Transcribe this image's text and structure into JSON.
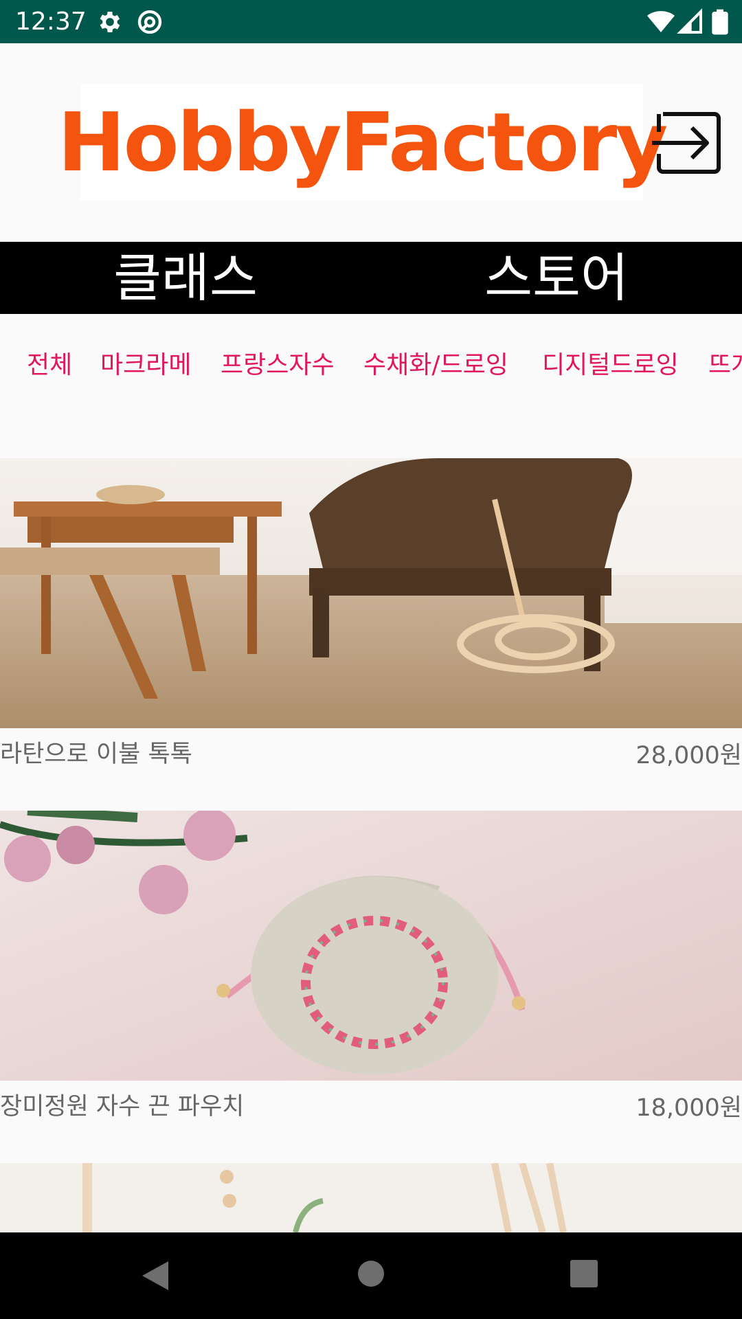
{
  "status_bar": {
    "time": "12:37",
    "icons": [
      "gear-icon",
      "data-saver-icon",
      "wifi-icon",
      "signal-icon",
      "battery-icon"
    ]
  },
  "header": {
    "logo_text": "HobbyFactory",
    "logo_color": "#f4540d",
    "login_icon": "login-icon"
  },
  "top_tabs": [
    {
      "label": "클래스"
    },
    {
      "label": "스토어"
    }
  ],
  "categories": [
    {
      "label": "전체"
    },
    {
      "label": "마크라메"
    },
    {
      "label": "프랑스자수"
    },
    {
      "label": "수채화/드로잉"
    },
    {
      "label": "디지털드로잉"
    },
    {
      "label": "뜨개"
    }
  ],
  "category_color": "#e2165e",
  "products": [
    {
      "name": "라탄으로 이불 톡톡",
      "price": "28,000원",
      "image": "rattan-bed-beater-photo"
    },
    {
      "name": "장미정원 자수 끈 파우치",
      "price": "18,000원",
      "image": "rose-embroidery-pouch-photo"
    },
    {
      "name": "",
      "price": "",
      "image": "macrame-hanger-photo"
    }
  ],
  "nav_bar": {
    "buttons": [
      "back-icon",
      "home-icon",
      "recents-icon"
    ]
  }
}
